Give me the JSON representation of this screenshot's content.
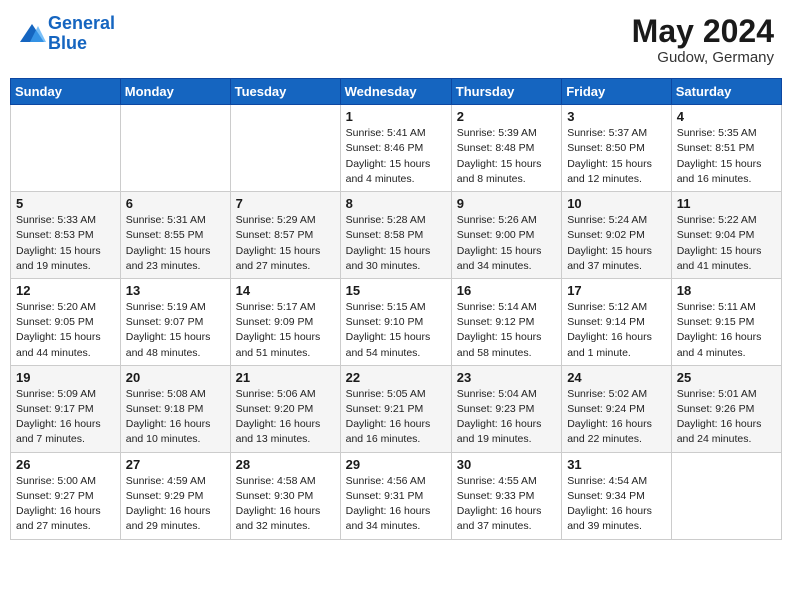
{
  "header": {
    "logo_line1": "General",
    "logo_line2": "Blue",
    "month": "May 2024",
    "location": "Gudow, Germany"
  },
  "weekdays": [
    "Sunday",
    "Monday",
    "Tuesday",
    "Wednesday",
    "Thursday",
    "Friday",
    "Saturday"
  ],
  "weeks": [
    [
      {
        "day": "",
        "info": ""
      },
      {
        "day": "",
        "info": ""
      },
      {
        "day": "",
        "info": ""
      },
      {
        "day": "1",
        "info": "Sunrise: 5:41 AM\nSunset: 8:46 PM\nDaylight: 15 hours\nand 4 minutes."
      },
      {
        "day": "2",
        "info": "Sunrise: 5:39 AM\nSunset: 8:48 PM\nDaylight: 15 hours\nand 8 minutes."
      },
      {
        "day": "3",
        "info": "Sunrise: 5:37 AM\nSunset: 8:50 PM\nDaylight: 15 hours\nand 12 minutes."
      },
      {
        "day": "4",
        "info": "Sunrise: 5:35 AM\nSunset: 8:51 PM\nDaylight: 15 hours\nand 16 minutes."
      }
    ],
    [
      {
        "day": "5",
        "info": "Sunrise: 5:33 AM\nSunset: 8:53 PM\nDaylight: 15 hours\nand 19 minutes."
      },
      {
        "day": "6",
        "info": "Sunrise: 5:31 AM\nSunset: 8:55 PM\nDaylight: 15 hours\nand 23 minutes."
      },
      {
        "day": "7",
        "info": "Sunrise: 5:29 AM\nSunset: 8:57 PM\nDaylight: 15 hours\nand 27 minutes."
      },
      {
        "day": "8",
        "info": "Sunrise: 5:28 AM\nSunset: 8:58 PM\nDaylight: 15 hours\nand 30 minutes."
      },
      {
        "day": "9",
        "info": "Sunrise: 5:26 AM\nSunset: 9:00 PM\nDaylight: 15 hours\nand 34 minutes."
      },
      {
        "day": "10",
        "info": "Sunrise: 5:24 AM\nSunset: 9:02 PM\nDaylight: 15 hours\nand 37 minutes."
      },
      {
        "day": "11",
        "info": "Sunrise: 5:22 AM\nSunset: 9:04 PM\nDaylight: 15 hours\nand 41 minutes."
      }
    ],
    [
      {
        "day": "12",
        "info": "Sunrise: 5:20 AM\nSunset: 9:05 PM\nDaylight: 15 hours\nand 44 minutes."
      },
      {
        "day": "13",
        "info": "Sunrise: 5:19 AM\nSunset: 9:07 PM\nDaylight: 15 hours\nand 48 minutes."
      },
      {
        "day": "14",
        "info": "Sunrise: 5:17 AM\nSunset: 9:09 PM\nDaylight: 15 hours\nand 51 minutes."
      },
      {
        "day": "15",
        "info": "Sunrise: 5:15 AM\nSunset: 9:10 PM\nDaylight: 15 hours\nand 54 minutes."
      },
      {
        "day": "16",
        "info": "Sunrise: 5:14 AM\nSunset: 9:12 PM\nDaylight: 15 hours\nand 58 minutes."
      },
      {
        "day": "17",
        "info": "Sunrise: 5:12 AM\nSunset: 9:14 PM\nDaylight: 16 hours\nand 1 minute."
      },
      {
        "day": "18",
        "info": "Sunrise: 5:11 AM\nSunset: 9:15 PM\nDaylight: 16 hours\nand 4 minutes."
      }
    ],
    [
      {
        "day": "19",
        "info": "Sunrise: 5:09 AM\nSunset: 9:17 PM\nDaylight: 16 hours\nand 7 minutes."
      },
      {
        "day": "20",
        "info": "Sunrise: 5:08 AM\nSunset: 9:18 PM\nDaylight: 16 hours\nand 10 minutes."
      },
      {
        "day": "21",
        "info": "Sunrise: 5:06 AM\nSunset: 9:20 PM\nDaylight: 16 hours\nand 13 minutes."
      },
      {
        "day": "22",
        "info": "Sunrise: 5:05 AM\nSunset: 9:21 PM\nDaylight: 16 hours\nand 16 minutes."
      },
      {
        "day": "23",
        "info": "Sunrise: 5:04 AM\nSunset: 9:23 PM\nDaylight: 16 hours\nand 19 minutes."
      },
      {
        "day": "24",
        "info": "Sunrise: 5:02 AM\nSunset: 9:24 PM\nDaylight: 16 hours\nand 22 minutes."
      },
      {
        "day": "25",
        "info": "Sunrise: 5:01 AM\nSunset: 9:26 PM\nDaylight: 16 hours\nand 24 minutes."
      }
    ],
    [
      {
        "day": "26",
        "info": "Sunrise: 5:00 AM\nSunset: 9:27 PM\nDaylight: 16 hours\nand 27 minutes."
      },
      {
        "day": "27",
        "info": "Sunrise: 4:59 AM\nSunset: 9:29 PM\nDaylight: 16 hours\nand 29 minutes."
      },
      {
        "day": "28",
        "info": "Sunrise: 4:58 AM\nSunset: 9:30 PM\nDaylight: 16 hours\nand 32 minutes."
      },
      {
        "day": "29",
        "info": "Sunrise: 4:56 AM\nSunset: 9:31 PM\nDaylight: 16 hours\nand 34 minutes."
      },
      {
        "day": "30",
        "info": "Sunrise: 4:55 AM\nSunset: 9:33 PM\nDaylight: 16 hours\nand 37 minutes."
      },
      {
        "day": "31",
        "info": "Sunrise: 4:54 AM\nSunset: 9:34 PM\nDaylight: 16 hours\nand 39 minutes."
      },
      {
        "day": "",
        "info": ""
      }
    ]
  ]
}
